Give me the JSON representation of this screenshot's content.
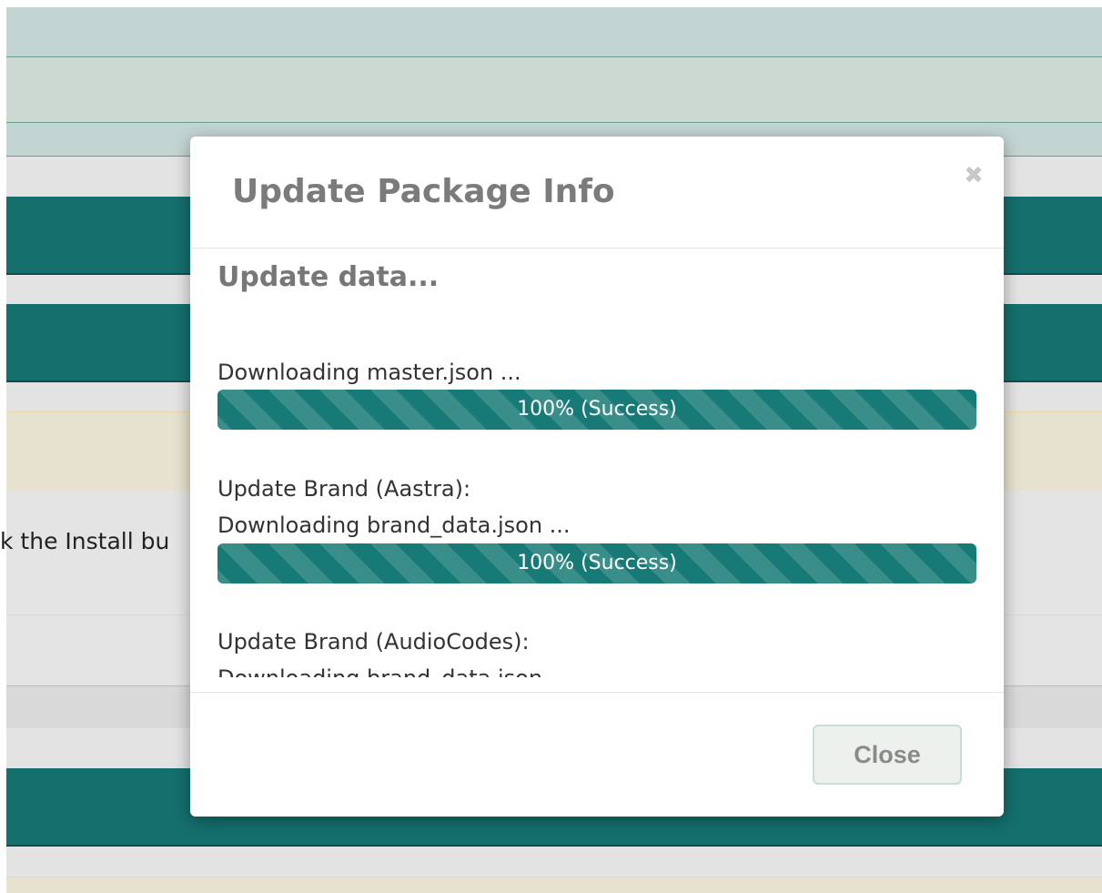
{
  "background": {
    "partial_text": "k the Install bu",
    "colors": {
      "teal_band": "#146f6d",
      "light_band": "#e3e3e3",
      "cream_band": "#e6e2cf"
    }
  },
  "modal": {
    "title": "Update Package Info",
    "close_icon": "close-icon",
    "body_heading": "Update data...",
    "entries": [
      {
        "lines": [
          "Downloading master.json ..."
        ],
        "progress": {
          "percent": 100,
          "label": "100% (Success)"
        }
      },
      {
        "lines": [
          "Update Brand (Aastra):",
          "Downloading brand_data.json ..."
        ],
        "progress": {
          "percent": 100,
          "label": "100% (Success)"
        }
      },
      {
        "lines": [
          "Update Brand (AudioCodes):",
          "Downloading brand_data.json ..."
        ]
      }
    ],
    "footer": {
      "close_label": "Close"
    }
  },
  "colors": {
    "progress": "#177a76",
    "title": "#7b7b7b"
  }
}
